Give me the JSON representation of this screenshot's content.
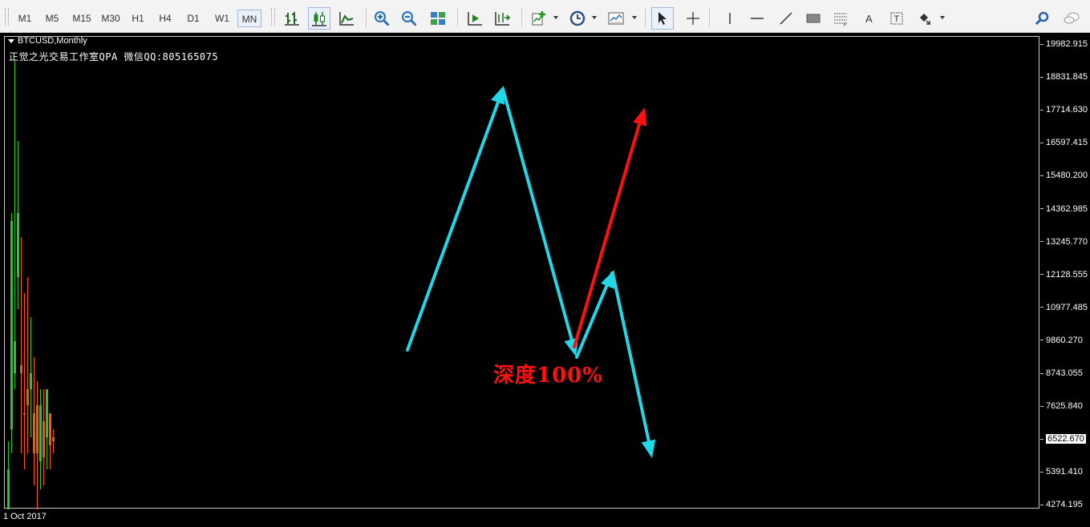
{
  "toolbar": {
    "timeframes": [
      "M1",
      "M5",
      "M15",
      "M30",
      "H1",
      "H4",
      "D1",
      "W1",
      "MN"
    ],
    "active_timeframe": "MN",
    "tools": [
      {
        "name": "bar-chart-icon"
      },
      {
        "name": "candlestick-chart-icon",
        "active": true
      },
      {
        "name": "line-chart-icon"
      },
      {
        "name": "zoom-in-icon"
      },
      {
        "name": "zoom-out-icon"
      },
      {
        "name": "tile-windows-icon"
      },
      {
        "name": "auto-scroll-icon"
      },
      {
        "name": "chart-shift-icon"
      },
      {
        "name": "indicators-icon"
      },
      {
        "name": "periods-icon"
      },
      {
        "name": "templates-icon"
      },
      {
        "name": "cursor-icon"
      },
      {
        "name": "crosshair-icon"
      },
      {
        "name": "vertical-line-icon"
      },
      {
        "name": "horizontal-line-icon"
      },
      {
        "name": "trendline-icon"
      },
      {
        "name": "rectangle-icon"
      },
      {
        "name": "fibonacci-icon"
      },
      {
        "name": "text-icon"
      },
      {
        "name": "text-label-icon"
      },
      {
        "name": "arrows-icon"
      },
      {
        "name": "search-icon"
      },
      {
        "name": "chat-icon"
      }
    ]
  },
  "chart": {
    "symbol_label": "BTCUSD,Monthly",
    "watermark_text": "正觉之光交易工作室QPA 微信QQ:805165075",
    "annotation_text": "深度100%",
    "x_label": "1 Oct 2017",
    "current_price": "6522.670",
    "colors": {
      "background": "#000000",
      "bull_candle": "#22cc22",
      "bear_candle": "#ff5500",
      "path_arrow": "#22d8e8",
      "projection_arrow": "#ff1111",
      "annotation": "#ff1111"
    }
  },
  "chart_data": {
    "type": "line",
    "y_ticks": [
      "19982.915",
      "18831.845",
      "17714.630",
      "16597.415",
      "15480.200",
      "14362.985",
      "13245.770",
      "12128.555",
      "10977.485",
      "9860.270",
      "8743.055",
      "7625.840",
      "6522.670",
      "5391.410",
      "4274.195"
    ],
    "ylim": [
      4274.195,
      19982.915
    ],
    "series": [
      {
        "values": [
          9860,
          18800,
          9400,
          12180,
          5700
        ]
      },
      {
        "values": [
          9600,
          17650
        ]
      }
    ]
  }
}
